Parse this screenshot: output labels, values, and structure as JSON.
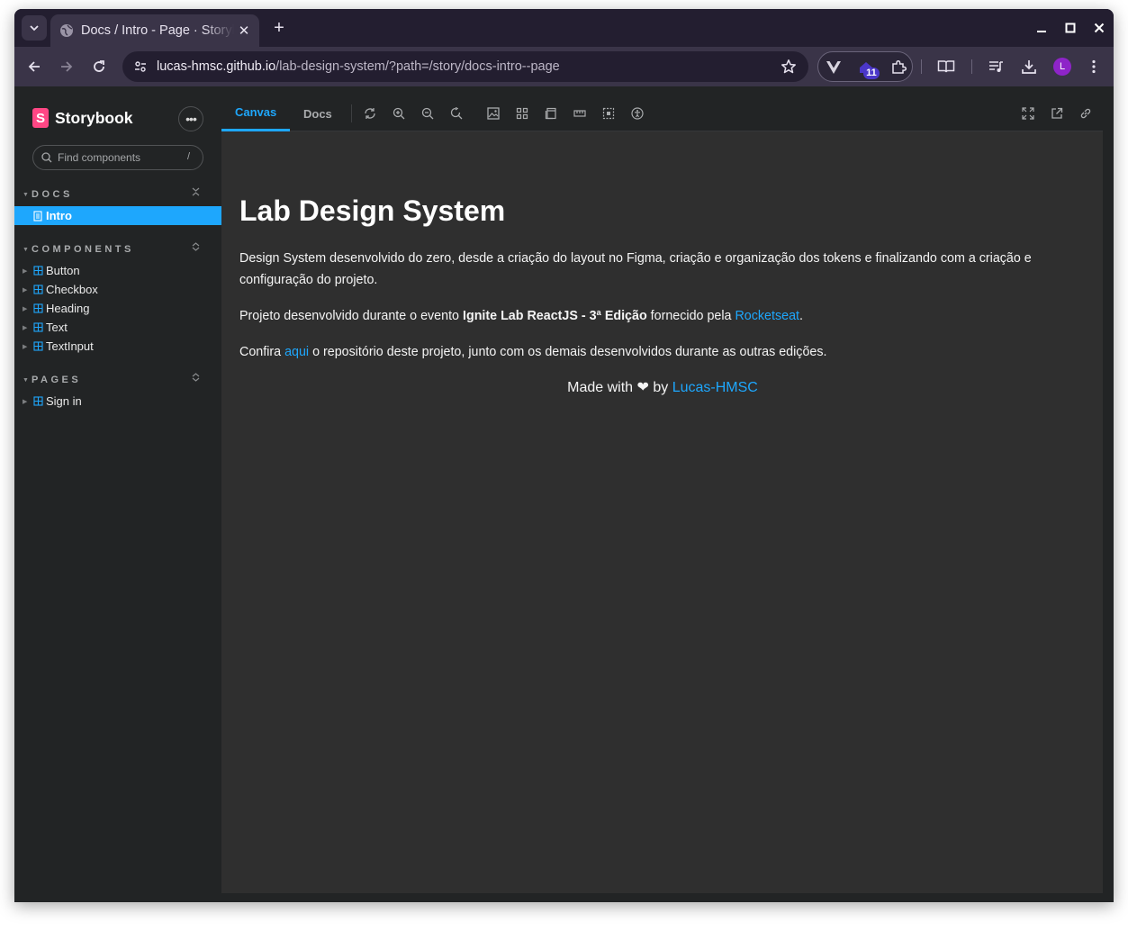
{
  "browser": {
    "tab_title": "Docs / Intro - Page · Storybook",
    "url_host": "lucas-hmsc.github.io",
    "url_path": "/lab-design-system/?path=/story/docs-intro--page",
    "extension_badge": "11",
    "profile_initial": "L"
  },
  "sidebar": {
    "brand": "Storybook",
    "brand_mark": "S",
    "search_placeholder": "Find components",
    "search_shortcut": "/",
    "sections": [
      {
        "label": "DOCS",
        "items": [
          {
            "label": "Intro",
            "selected": true
          }
        ]
      },
      {
        "label": "COMPONENTS",
        "items": [
          {
            "label": "Button"
          },
          {
            "label": "Checkbox"
          },
          {
            "label": "Heading"
          },
          {
            "label": "Text"
          },
          {
            "label": "TextInput"
          }
        ]
      },
      {
        "label": "PAGES",
        "items": [
          {
            "label": "Sign in"
          }
        ]
      }
    ]
  },
  "preview": {
    "tabs": [
      "Canvas",
      "Docs"
    ],
    "active_tab": "Canvas"
  },
  "doc": {
    "title": "Lab Design System",
    "p1": "Design System desenvolvido do zero, desde a criação do layout no Figma, criação e organização dos tokens e finalizando com a criação e configuração do projeto.",
    "p2_pre": "Projeto desenvolvido durante o evento ",
    "p2_bold": "Ignite Lab ReactJS - 3ª Edição",
    "p2_mid": " fornecido pela ",
    "p2_link": "Rocketseat",
    "p2_post": ".",
    "p3_pre": "Confira ",
    "p3_link": "aqui",
    "p3_post": " o repositório deste projeto, junto com os demais desenvolvidos durante as outras edições.",
    "credit_pre": "Made with ❤ by ",
    "credit_link": "Lucas-HMSC"
  },
  "colors": {
    "accent": "#1ea7fd",
    "storybook_pink": "#ff4785",
    "sidebar_bg": "#222425",
    "canvas_bg": "#2f2f2f"
  }
}
